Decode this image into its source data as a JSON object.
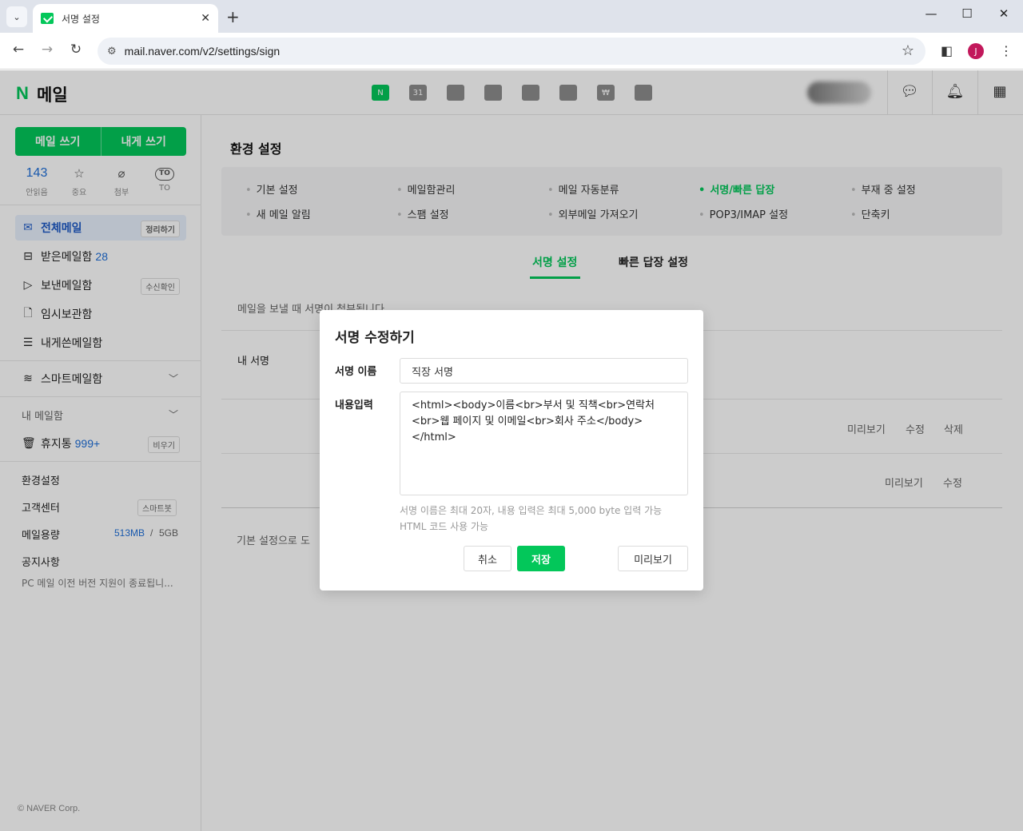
{
  "browser": {
    "tab_title": "서명 설정",
    "url": "mail.naver.com/v2/settings/sign",
    "profile_initial": "J"
  },
  "header": {
    "logo_n": "N",
    "logo_text": "메일",
    "services": [
      {
        "icon": "mail-icon",
        "text": "N"
      },
      {
        "icon": "calendar-icon",
        "text": "31"
      },
      {
        "icon": "memo-icon",
        "text": ""
      },
      {
        "icon": "contacts-icon",
        "text": ""
      },
      {
        "icon": "mybox-icon",
        "text": ""
      },
      {
        "icon": "todo-icon",
        "text": ""
      },
      {
        "icon": "household-icon",
        "text": "₩"
      },
      {
        "icon": "bookmark-icon",
        "text": ""
      }
    ]
  },
  "sidebar": {
    "write_mail": "메일 쓰기",
    "write_self": "내게 쓰기",
    "quick": [
      {
        "top": "143",
        "label": "안읽음"
      },
      {
        "top": "☆",
        "label": "중요"
      },
      {
        "top": "⌀",
        "label": "첨부"
      },
      {
        "top": "TO",
        "label": "TO"
      }
    ],
    "folders": {
      "all": {
        "label": "전체메일",
        "badge": "정리하기"
      },
      "inbox": {
        "label": "받은메일함",
        "count": "28"
      },
      "sent": {
        "label": "보낸메일함",
        "badge": "수신확인"
      },
      "drafts": {
        "label": "임시보관함"
      },
      "self": {
        "label": "내게쓴메일함"
      },
      "smart": {
        "label": "스마트메일함"
      },
      "my": {
        "label": "내 메일함"
      },
      "trash": {
        "label": "휴지통",
        "count": "999+",
        "badge": "비우기"
      }
    },
    "settings": "환경설정",
    "support": "고객센터",
    "support_badge": "스마트봇",
    "storage_label": "메일용량",
    "storage_used": "513MB",
    "storage_sep": "/",
    "storage_total": "5GB",
    "notice_label": "공지사항",
    "notice_text": "PC 메일 이전 버전 지원이 종료됩니...",
    "copyright": "© NAVER Corp."
  },
  "main": {
    "title": "환경 설정",
    "menu": [
      "기본 설정",
      "메일함관리",
      "메일 자동분류",
      "서명/빠른 답장",
      "부재 중 설정",
      "새 메일 알림",
      "스팸 설정",
      "외부메일 가져오기",
      "POP3/IMAP 설정",
      "단축키"
    ],
    "tabs": {
      "sign": "서명 설정",
      "quick_reply": "빠른 답장 설정"
    },
    "desc": "메일을 보낼 때 서명이 첨부됩니다",
    "my_sign": "내 서명",
    "row1": {
      "preview": "미리보기",
      "edit": "수정",
      "delete": "삭제"
    },
    "row2": {
      "preview": "미리보기",
      "edit": "수정"
    },
    "bottom": "기본 설정으로 도"
  },
  "dialog": {
    "title": "서명 수정하기",
    "name_label": "서명 이름",
    "name_value": "직장 서명",
    "content_label": "내용입력",
    "content_value": "<html><body>이름<br>부서 및 직책<br>연락처<br>웹 페이지 및 이메일<br>회사 주소</body></html>",
    "help_1": "서명 이름은 최대 20자, 내용 입력은 최대 5,000 byte 입력 가능",
    "help_2": "HTML 코드 사용 가능",
    "cancel": "취소",
    "save": "저장",
    "preview": "미리보기"
  }
}
